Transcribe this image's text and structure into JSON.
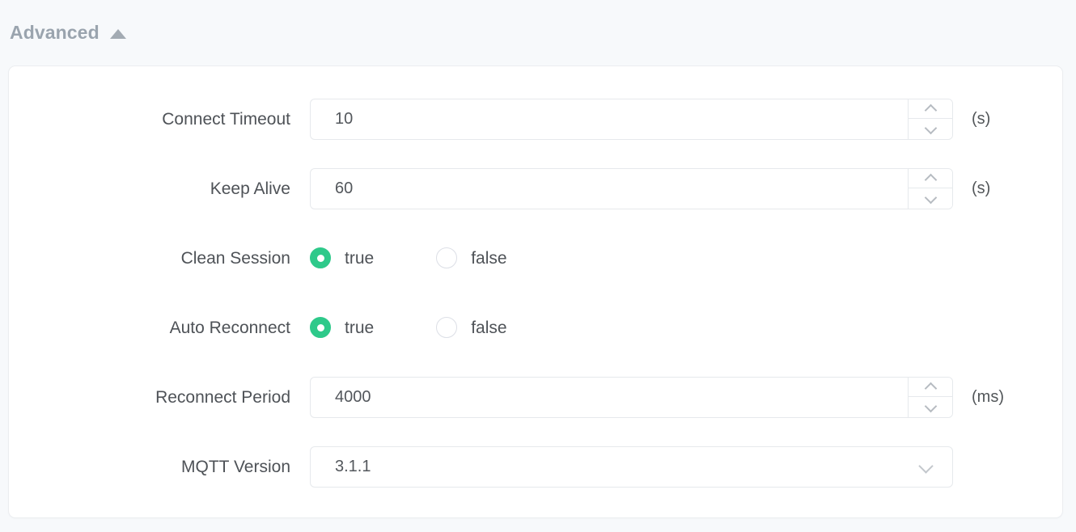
{
  "section": {
    "title": "Advanced",
    "collapse_icon": "triangle-up-icon",
    "expanded": true
  },
  "fields": {
    "connect_timeout": {
      "label": "Connect Timeout",
      "value": "10",
      "unit": "(s)",
      "type": "number",
      "spinner_up_icon": "chevron-up-icon",
      "spinner_down_icon": "chevron-down-icon"
    },
    "keep_alive": {
      "label": "Keep Alive",
      "value": "60",
      "unit": "(s)",
      "type": "number",
      "spinner_up_icon": "chevron-up-icon",
      "spinner_down_icon": "chevron-down-icon"
    },
    "clean_session": {
      "label": "Clean Session",
      "type": "radio",
      "selected": "true",
      "options": [
        {
          "label": "true",
          "checked": true
        },
        {
          "label": "false",
          "checked": false
        }
      ]
    },
    "auto_reconnect": {
      "label": "Auto Reconnect",
      "type": "radio",
      "selected": "true",
      "options": [
        {
          "label": "true",
          "checked": true
        },
        {
          "label": "false",
          "checked": false
        }
      ]
    },
    "reconnect_period": {
      "label": "Reconnect Period",
      "value": "4000",
      "unit": "(ms)",
      "type": "number",
      "spinner_up_icon": "chevron-up-icon",
      "spinner_down_icon": "chevron-down-icon"
    },
    "mqtt_version": {
      "label": "MQTT Version",
      "value": "3.1.1",
      "type": "select",
      "caret_icon": "chevron-down-icon"
    }
  },
  "colors": {
    "page_background": "#f7f9fb",
    "card_background": "#ffffff",
    "accent_green": "#2ec98a",
    "label_text": "#4e5257",
    "header_text": "#9aa4ae",
    "border": "#e6e9ec"
  }
}
